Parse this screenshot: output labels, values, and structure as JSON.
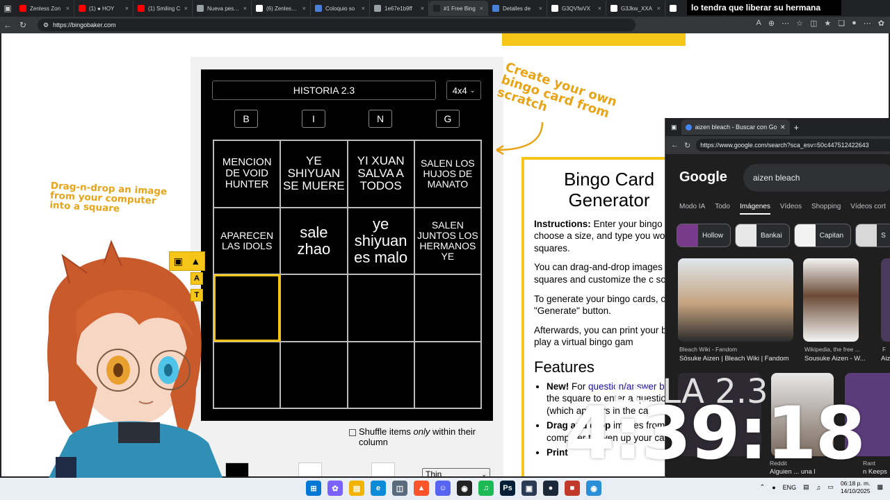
{
  "browser": {
    "tabs": [
      {
        "label": "Zenless Zon",
        "color": "#ff0000"
      },
      {
        "label": "(1) ● HOY",
        "color": "#ff0000"
      },
      {
        "label": "(1) Smiling C",
        "color": "#ff0000"
      },
      {
        "label": "Nueva pestaña",
        "color": "#9aa0a6"
      },
      {
        "label": "(6) Zenless Z",
        "color": "#ffffff"
      },
      {
        "label": "Coloquio so",
        "color": "#4a7fd8"
      },
      {
        "label": "1e67e1b9ff",
        "color": "#9aa0a6"
      },
      {
        "label": "#1 Free Bing",
        "color": "#202124"
      },
      {
        "label": "Detalles de",
        "color": "#4a7fd8"
      },
      {
        "label": "G3QVfwVX",
        "color": "#ffffff"
      },
      {
        "label": "G3Jkw_XXA",
        "color": "#ffffff"
      },
      {
        "label": "",
        "color": "#ffffff"
      }
    ],
    "url": "https://bingobaker.com",
    "overlay_text": "lo tendra que liberar su hermana"
  },
  "bingo": {
    "title": "HISTORIA 2.3",
    "size": "4x4",
    "letters": [
      "B",
      "I",
      "N",
      "G"
    ],
    "cells": [
      "MENCION DE VOID HUNTER",
      "YE SHIYUAN SE MUERE",
      "YI XUAN SALVA A TODOS",
      "SALEN LOS HUJOS DE MANATO",
      "APARECEN LAS IDOLS",
      "sale zhao",
      "ye shiyuan es malo",
      "SALEN JUNTOS LOS HERMANOS YE",
      "",
      "",
      "",
      "",
      "",
      "",
      "",
      ""
    ],
    "shuffle_label_1": "Shuffle items ",
    "shuffle_label_em": "only",
    "shuffle_label_2": " within their column",
    "line_select": "Thin",
    "swatch_colors": [
      "#000000",
      "#ffffff",
      "#ffffff"
    ]
  },
  "annotations": {
    "create": "Create your own bingo card from scratch",
    "drag": "Drag-n-drop an image from your computer into a square"
  },
  "info": {
    "title": "Bingo Card Generator",
    "instructions_label": "Instructions:",
    "instructions_text": " Enter your bingo c title, choose a size, and type you words into the squares.",
    "p2": "You can drag-and-drop images in the squares and customize the c scheme.",
    "p3": "To generate your bingo cards, cli the \"Generate\" button.",
    "p4": "Afterwards, you can print your bi cards, or play a virtual bingo gam",
    "features_title": "Features",
    "f1_bold": "New!",
    "f1_text": " For ",
    "f1_link": "question/answer bingo",
    "f1_rest": ", flip over the square to enter a question/clue (which appears in the call list)",
    "f2_bold": "Drag and drop",
    "f2_text": " images from your computer to liven up your card",
    "f3_bold": "Print"
  },
  "google": {
    "tab_title": "aizen bleach - Buscar con Google",
    "url": "https://www.google.com/search?sca_esv=50c447512422643",
    "logo": "Google",
    "query": "aizen bleach",
    "tabs": [
      "Modo IA",
      "Todo",
      "Imágenes",
      "Vídeos",
      "Shopping",
      "Vídeos cort"
    ],
    "chips": [
      "Hollow",
      "Bankai",
      "Capitan",
      "S"
    ],
    "results": [
      {
        "source": "Bleach Wiki - Fandom",
        "title": "Sōsuke Aizen | Bleach Wiki | Fandom"
      },
      {
        "source": "Wikipedia, the free ...",
        "title": "Sousuke Aizen - W..."
      },
      {
        "source": "F",
        "title": "Aiz"
      }
    ],
    "results2": [
      {
        "source": "Reddit",
        "title": "Alguien ... una l"
      },
      {
        "source": "Rant",
        "title": "n Keeps"
      }
    ]
  },
  "overlay": {
    "clock": "4:39:18",
    "label": "LE LA 2.3"
  },
  "taskbar": {
    "lang": "ENG",
    "time": "06:18 p. m.",
    "date": "14/10/2025"
  }
}
